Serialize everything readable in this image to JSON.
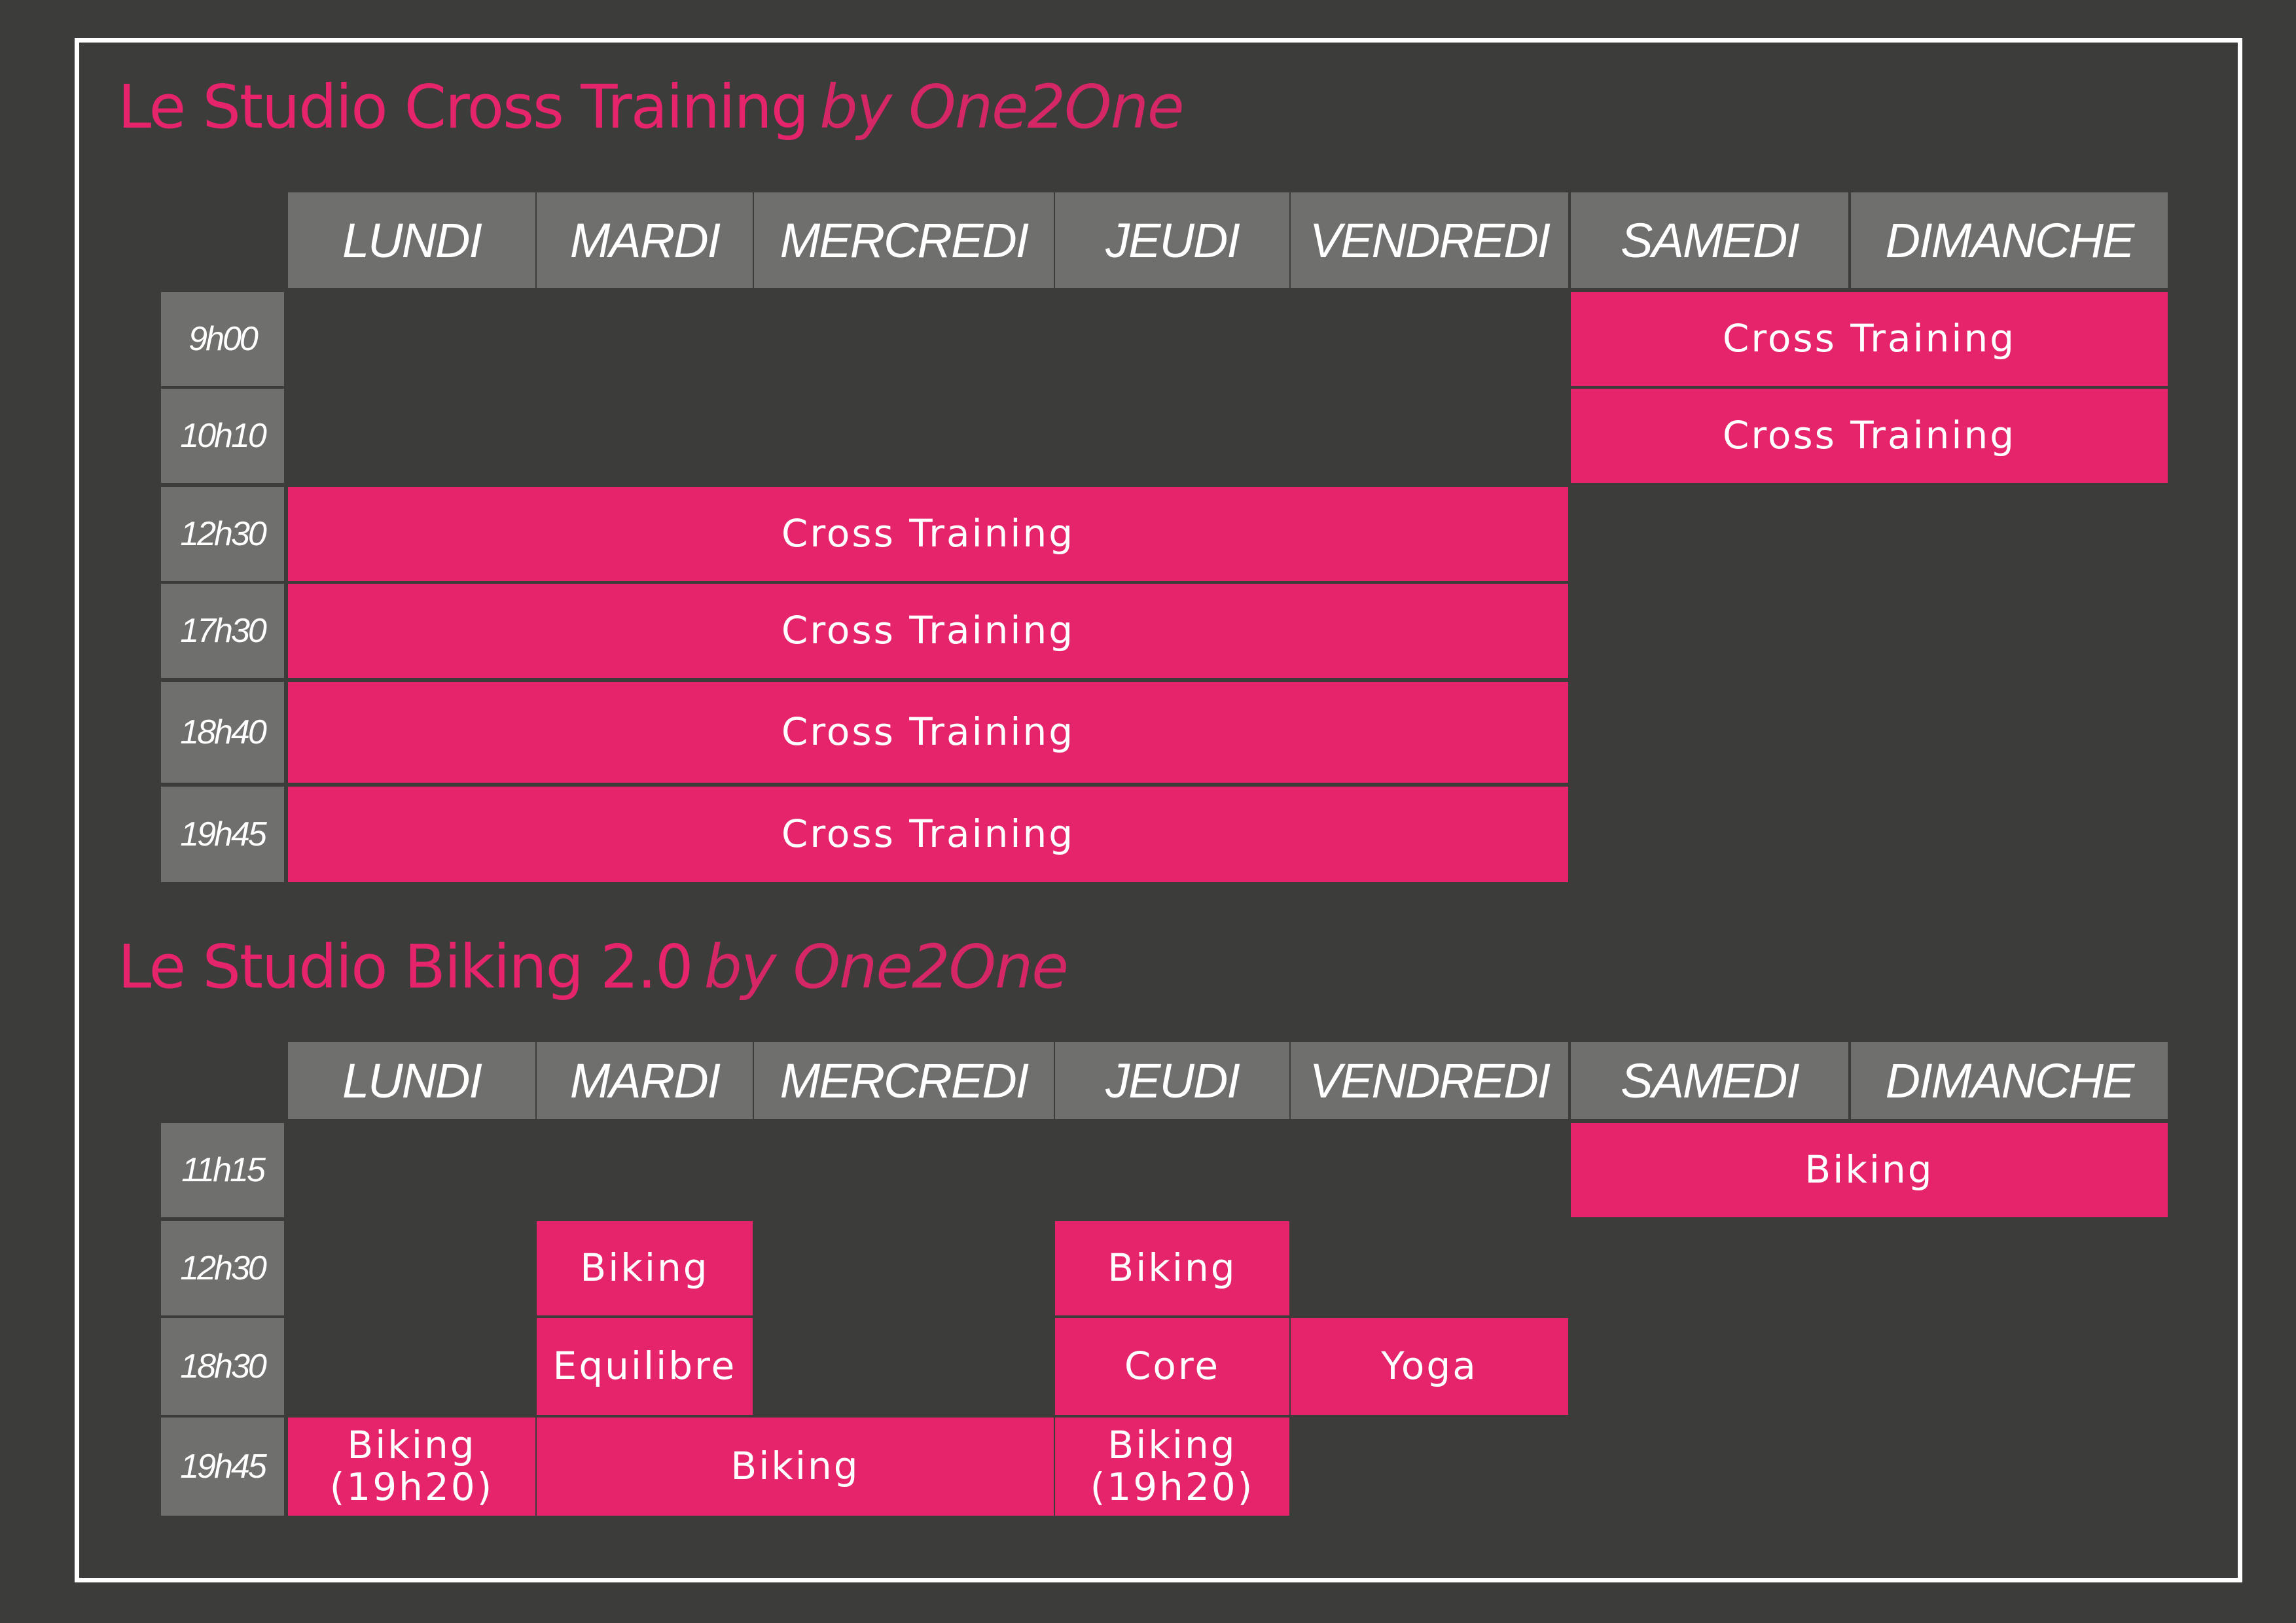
{
  "colors": {
    "background": "#3c3c3b",
    "accent": "#e6246b",
    "header": "#6f6f6e",
    "border": "#ffffff"
  },
  "days": [
    "LUNDI",
    "MARDI",
    "MERCREDI",
    "JEUDI",
    "VENDREDI",
    "SAMEDI",
    "DIMANCHE"
  ],
  "cross_training": {
    "title": "Le Studio Cross Training",
    "subtitle": "by One2One",
    "times": [
      "9h00",
      "10h10",
      "12h30",
      "17h30",
      "18h40",
      "19h45"
    ],
    "classes": [
      {
        "time": "9h00",
        "days": [
          "SAMEDI",
          "DIMANCHE"
        ],
        "label": "Cross Training"
      },
      {
        "time": "10h10",
        "days": [
          "SAMEDI",
          "DIMANCHE"
        ],
        "label": "Cross Training"
      },
      {
        "time": "12h30",
        "days": [
          "LUNDI",
          "MARDI",
          "MERCREDI",
          "JEUDI",
          "VENDREDI"
        ],
        "label": "Cross Training"
      },
      {
        "time": "17h30",
        "days": [
          "LUNDI",
          "MARDI",
          "MERCREDI",
          "JEUDI",
          "VENDREDI"
        ],
        "label": "Cross Training"
      },
      {
        "time": "18h40",
        "days": [
          "LUNDI",
          "MARDI",
          "MERCREDI",
          "JEUDI",
          "VENDREDI"
        ],
        "label": "Cross Training"
      },
      {
        "time": "19h45",
        "days": [
          "LUNDI",
          "MARDI",
          "MERCREDI",
          "JEUDI",
          "VENDREDI"
        ],
        "label": "Cross Training"
      }
    ]
  },
  "biking": {
    "title": "Le Studio Biking 2.0",
    "subtitle": "by One2One",
    "times": [
      "11h15",
      "12h30",
      "18h30",
      "19h45"
    ],
    "classes": [
      {
        "time": "11h15",
        "days": [
          "SAMEDI",
          "DIMANCHE"
        ],
        "label": "Biking"
      },
      {
        "time": "12h30",
        "days": [
          "MARDI"
        ],
        "label": "Biking"
      },
      {
        "time": "12h30",
        "days": [
          "JEUDI"
        ],
        "label": "Biking"
      },
      {
        "time": "18h30",
        "days": [
          "MARDI"
        ],
        "label": "Equilibre"
      },
      {
        "time": "18h30",
        "days": [
          "JEUDI"
        ],
        "label": "Core"
      },
      {
        "time": "18h30",
        "days": [
          "VENDREDI"
        ],
        "label": "Yoga"
      },
      {
        "time": "19h45",
        "days": [
          "LUNDI"
        ],
        "label": "Biking\n(19h20)"
      },
      {
        "time": "19h45",
        "days": [
          "MARDI",
          "MERCREDI"
        ],
        "label": "Biking"
      },
      {
        "time": "19h45",
        "days": [
          "JEUDI"
        ],
        "label": "Biking\n(19h20)"
      }
    ]
  }
}
